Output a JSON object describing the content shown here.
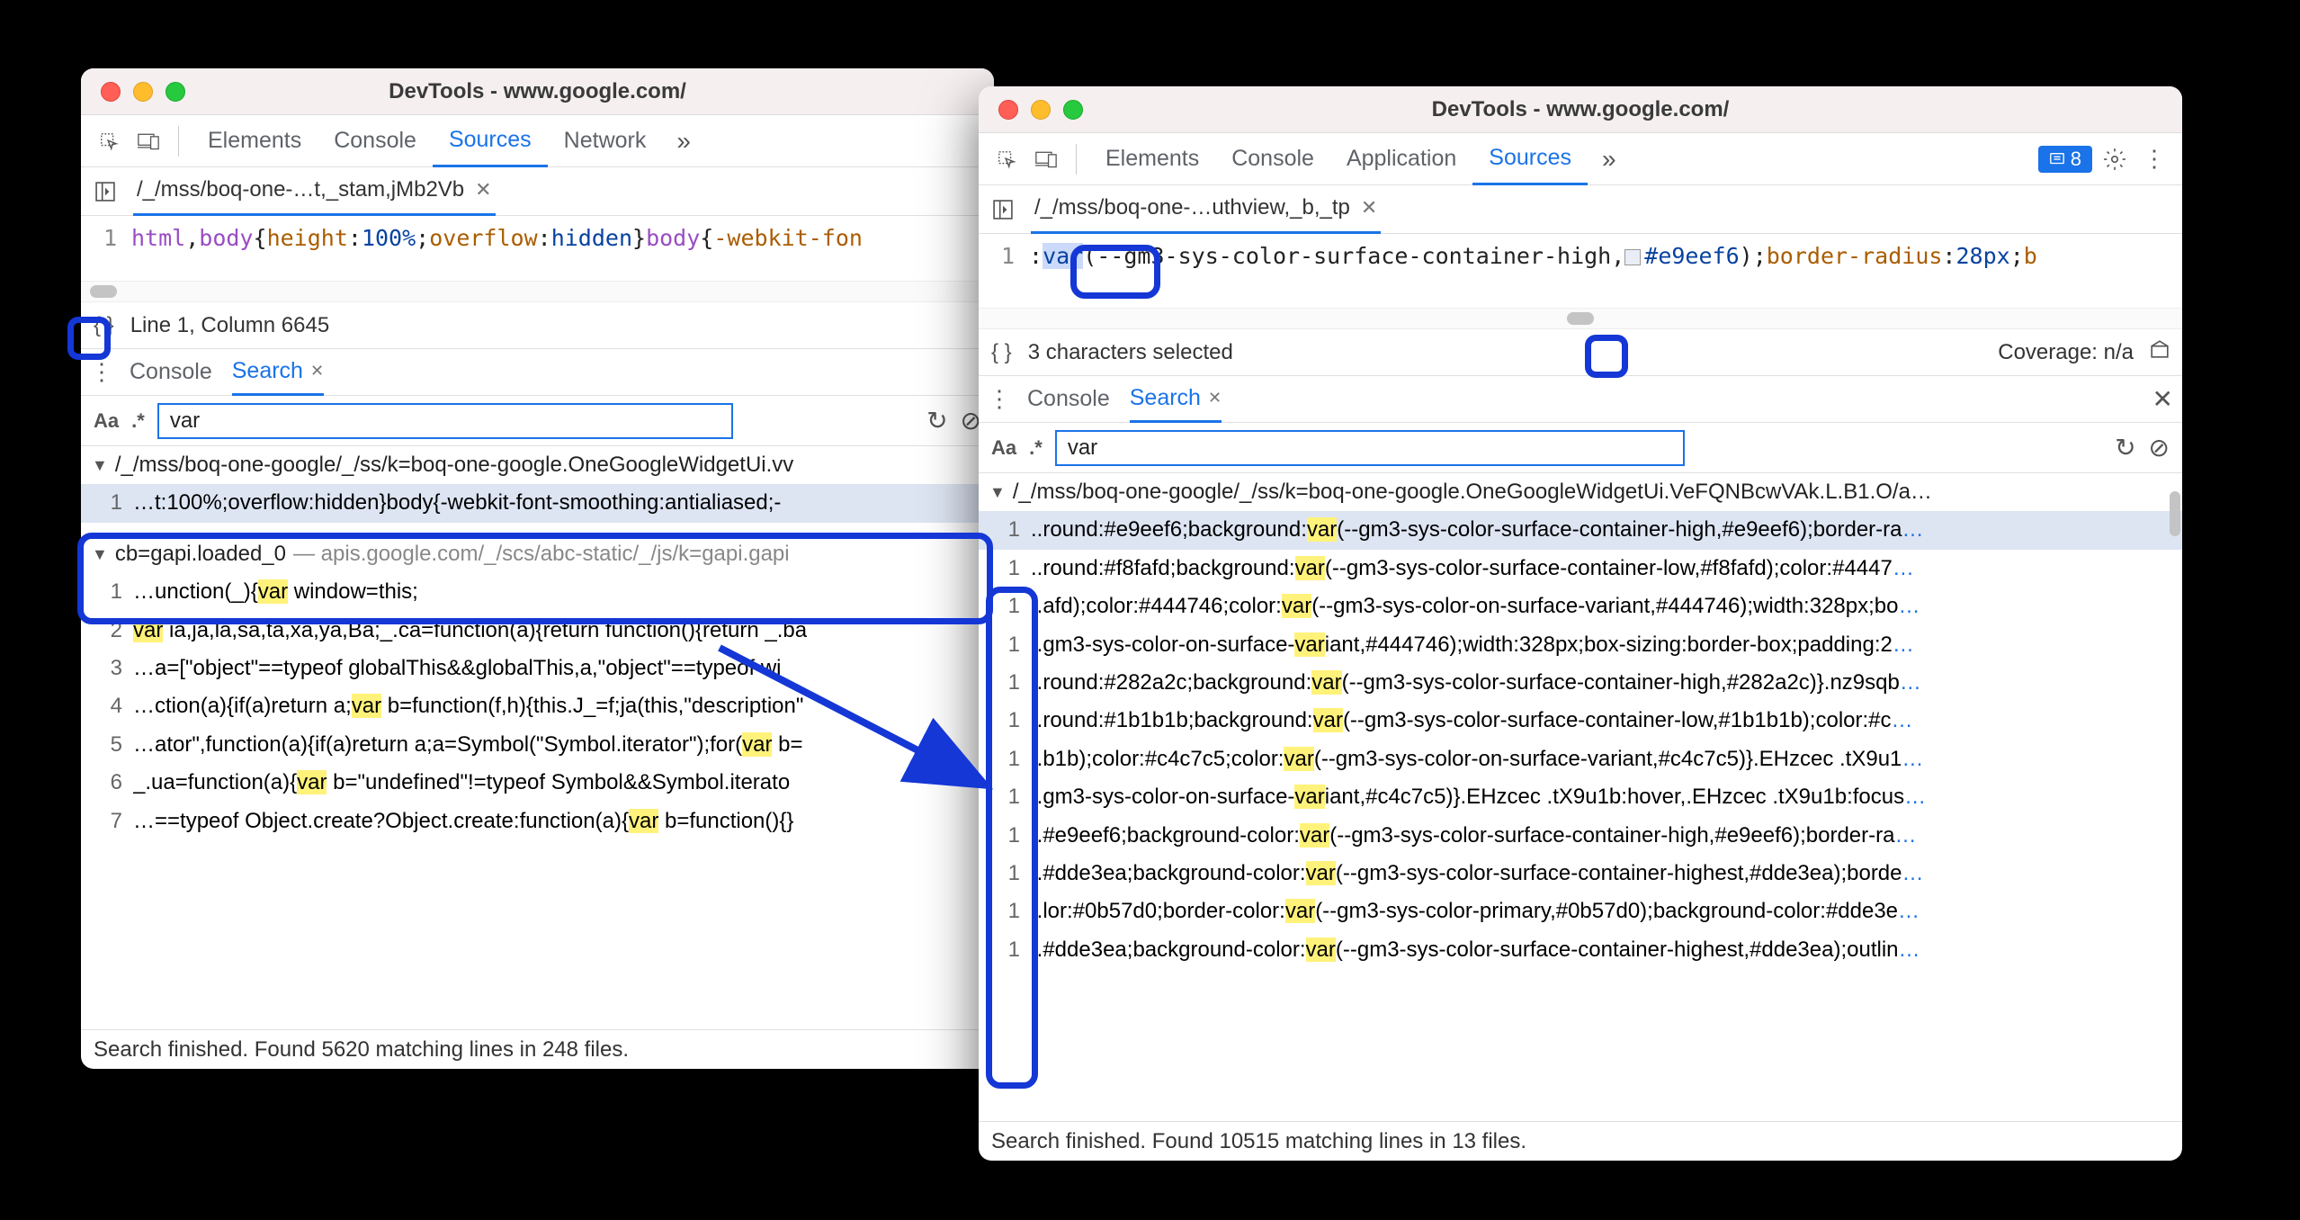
{
  "left": {
    "title": "DevTools - www.google.com/",
    "tabs": [
      "Elements",
      "Console",
      "Sources",
      "Network"
    ],
    "activeTab": "Sources",
    "fileTab": "/_/mss/boq-one-…t,_stam,jMb2Vb",
    "codeLineNum": "1",
    "code_pre": "html",
    "code_comma1": ",",
    "code_body": "body",
    "code_brace1": "{",
    "code_prop1": "height",
    "code_colon1": ":",
    "code_val1": "100%",
    "code_semi1": ";",
    "code_prop2": "overflow",
    "code_colon2": ":",
    "code_val2": "hidden",
    "code_brace2": "}",
    "code_body2": "body",
    "code_brace3": "{",
    "code_prop3": "-webkit-fon",
    "status": "Line 1, Column 6645",
    "drawerTabs": [
      "Console",
      "Search"
    ],
    "searchQuery": "var",
    "group1_tri": "▼",
    "group1_path": "/_/mss/boq-one-google/_/ss/k=boq-one-google.OneGoogleWidgetUi.vv",
    "results1": [
      {
        "num": "1",
        "pre": "…t:100%;overflow:hidden}body{-webkit-font-smoothing:antialiased;-",
        "hl": "",
        "post": ""
      }
    ],
    "group2_tri": "▼",
    "group2_name": "cb=gapi.loaded_0",
    "group2_sep": "—",
    "group2_path": "apis.google.com/_/scs/abc-static/_/js/k=gapi.gapi",
    "results2": [
      {
        "num": "1",
        "pre": "…unction(_){",
        "hl": "var",
        "post": " window=this;"
      },
      {
        "num": "2",
        "pre": "",
        "hl": "var",
        "post": " ia,ja,la,sa,ta,xa,ya,Ba;_.ca=function(a){return function(){return _.ba"
      },
      {
        "num": "3",
        "pre": "…a=[\"object\"==typeof globalThis&&globalThis,a,\"object\"==typeof wi",
        "hl": "",
        "post": ""
      },
      {
        "num": "4",
        "pre": "…ction(a){if(a)return a;",
        "hl": "var",
        "post": " b=function(f,h){this.J_=f;ja(this,\"description\""
      },
      {
        "num": "5",
        "pre": "…ator\",function(a){if(a)return a;a=Symbol(\"Symbol.iterator\");for(",
        "hl": "var",
        "post": " b="
      },
      {
        "num": "6",
        "pre": "_.ua=function(a){",
        "hl": "var",
        "post": " b=\"undefined\"!=typeof Symbol&&Symbol.iterato"
      },
      {
        "num": "7",
        "pre": "…==typeof Object.create?Object.create:function(a){",
        "hl": "var",
        "post": " b=function(){}"
      }
    ],
    "footer": "Search finished.  Found 5620 matching lines in 248 files."
  },
  "right": {
    "title": "DevTools - www.google.com/",
    "tabs": [
      "Elements",
      "Console",
      "Application",
      "Sources"
    ],
    "activeTab": "Sources",
    "badgeCount": "8",
    "fileTab": "/_/mss/boq-one-…uthview,_b,_tp",
    "codeLineNum": "1",
    "code_colon": ":",
    "code_var": "var",
    "code_open": "(",
    "code_arg": "--gm3-sys-color-surface-container-high,",
    "code_hex": "#e9eef6",
    "code_close": ");",
    "code_prop": "border-radius",
    "code_colon2": ":",
    "code_val": "28px",
    "code_semi": ";",
    "code_b": "b",
    "status": "3 characters selected",
    "coverage": "Coverage: n/a",
    "drawerTabs": [
      "Console",
      "Search"
    ],
    "searchQuery": "var",
    "group_tri": "▼",
    "group_path": "/_/mss/boq-one-google/_/ss/k=boq-one-google.OneGoogleWidgetUi.VeFQNBcwVAk.L.B1.O/a…",
    "results": [
      {
        "num": "1",
        "pre": "..round:#e9eef6;background:",
        "hl": "var",
        "post": "(--gm3-sys-color-surface-container-high,#e9eef6);border-ra"
      },
      {
        "num": "1",
        "pre": "..round:#f8fafd;background:",
        "hl": "var",
        "post": "(--gm3-sys-color-surface-container-low,#f8fafd);color:#4447"
      },
      {
        "num": "1",
        "pre": "..afd);color:#444746;color:",
        "hl": "var",
        "post": "(--gm3-sys-color-on-surface-variant,#444746);width:328px;bo"
      },
      {
        "num": "1",
        "pre": "..gm3-sys-color-on-surface-",
        "hl": "var",
        "post": "iant,#444746);width:328px;box-sizing:border-box;padding:2"
      },
      {
        "num": "1",
        "pre": "..round:#282a2c;background:",
        "hl": "var",
        "post": "(--gm3-sys-color-surface-container-high,#282a2c)}.nz9sqb"
      },
      {
        "num": "1",
        "pre": "..round:#1b1b1b;background:",
        "hl": "var",
        "post": "(--gm3-sys-color-surface-container-low,#1b1b1b);color:#c"
      },
      {
        "num": "1",
        "pre": "..b1b);color:#c4c7c5;color:",
        "hl": "var",
        "post": "(--gm3-sys-color-on-surface-variant,#c4c7c5)}.EHzcec .tX9u1"
      },
      {
        "num": "1",
        "pre": "..gm3-sys-color-on-surface-",
        "hl": "var",
        "post": "iant,#c4c7c5)}.EHzcec .tX9u1b:hover,.EHzcec .tX9u1b:focus"
      },
      {
        "num": "1",
        "pre": "..#e9eef6;background-color:",
        "hl": "var",
        "post": "(--gm3-sys-color-surface-container-high,#e9eef6);border-ra"
      },
      {
        "num": "1",
        "pre": "..#dde3ea;background-color:",
        "hl": "var",
        "post": "(--gm3-sys-color-surface-container-highest,#dde3ea);borde"
      },
      {
        "num": "1",
        "pre": "..lor:#0b57d0;border-color:",
        "hl": "var",
        "post": "(--gm3-sys-color-primary,#0b57d0);background-color:#dde3e"
      },
      {
        "num": "1",
        "pre": "..#dde3ea;background-color:",
        "hl": "var",
        "post": "(--gm3-sys-color-surface-container-highest,#dde3ea);outlin"
      }
    ],
    "footer": "Search finished.  Found 10515 matching lines in 13 files."
  }
}
